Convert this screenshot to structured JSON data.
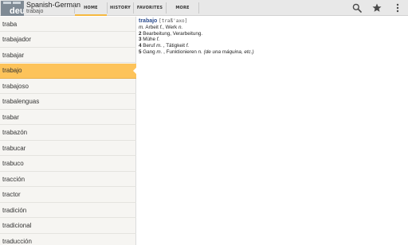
{
  "app": {
    "icon_text": "deu",
    "title": "Spanish-German",
    "current_word": "trabajo"
  },
  "tabs": [
    {
      "label": "HOME",
      "active": true
    },
    {
      "label": "HISTORY",
      "active": false
    },
    {
      "label": "FAVORITES",
      "active": false
    },
    {
      "label": "MORE",
      "active": false
    }
  ],
  "actions": [
    {
      "icon": "search-icon"
    },
    {
      "icon": "star-icon"
    },
    {
      "icon": "overflow-menu-icon"
    }
  ],
  "colors": {
    "accent": "#fdc35a",
    "headword": "#2c4d8e"
  },
  "word_list": {
    "items": [
      "traba",
      "trabajador",
      "trabajar",
      "trabajo",
      "trabajoso",
      "trabalenguas",
      "trabar",
      "trabazón",
      "trabucar",
      "trabuco",
      "tracción",
      "tractor",
      "tradición",
      "tradicional",
      "traducción"
    ],
    "selected": "trabajo"
  },
  "entry": {
    "headword": "trabajo",
    "phonetic": "[traß'axo]",
    "senses": [
      {
        "num": "",
        "parts": [
          {
            "t": "m.",
            "i": true
          },
          {
            "t": " Arbeit ",
            "i": false
          },
          {
            "t": "f.",
            "i": true
          },
          {
            "t": ", Werk ",
            "i": false
          },
          {
            "t": "n.",
            "i": true
          }
        ]
      },
      {
        "num": "2",
        "parts": [
          {
            "t": " Bearbeitung, Verarbeitung.",
            "i": false
          }
        ]
      },
      {
        "num": "3",
        "parts": [
          {
            "t": " Mühe ",
            "i": false
          },
          {
            "t": "f.",
            "i": true
          }
        ]
      },
      {
        "num": "4",
        "parts": [
          {
            "t": " Beruf ",
            "i": false
          },
          {
            "t": "m.",
            "i": true
          },
          {
            "t": " , Tätigkeit ",
            "i": false
          },
          {
            "t": "f.",
            "i": true
          }
        ]
      },
      {
        "num": "5",
        "parts": [
          {
            "t": " Gang ",
            "i": false
          },
          {
            "t": "m.",
            "i": true
          },
          {
            "t": " , Funktionieren ",
            "i": false
          },
          {
            "t": "n.",
            "i": true
          },
          {
            "t": " (de una máquina, etc.)",
            "i": true
          }
        ]
      }
    ]
  }
}
